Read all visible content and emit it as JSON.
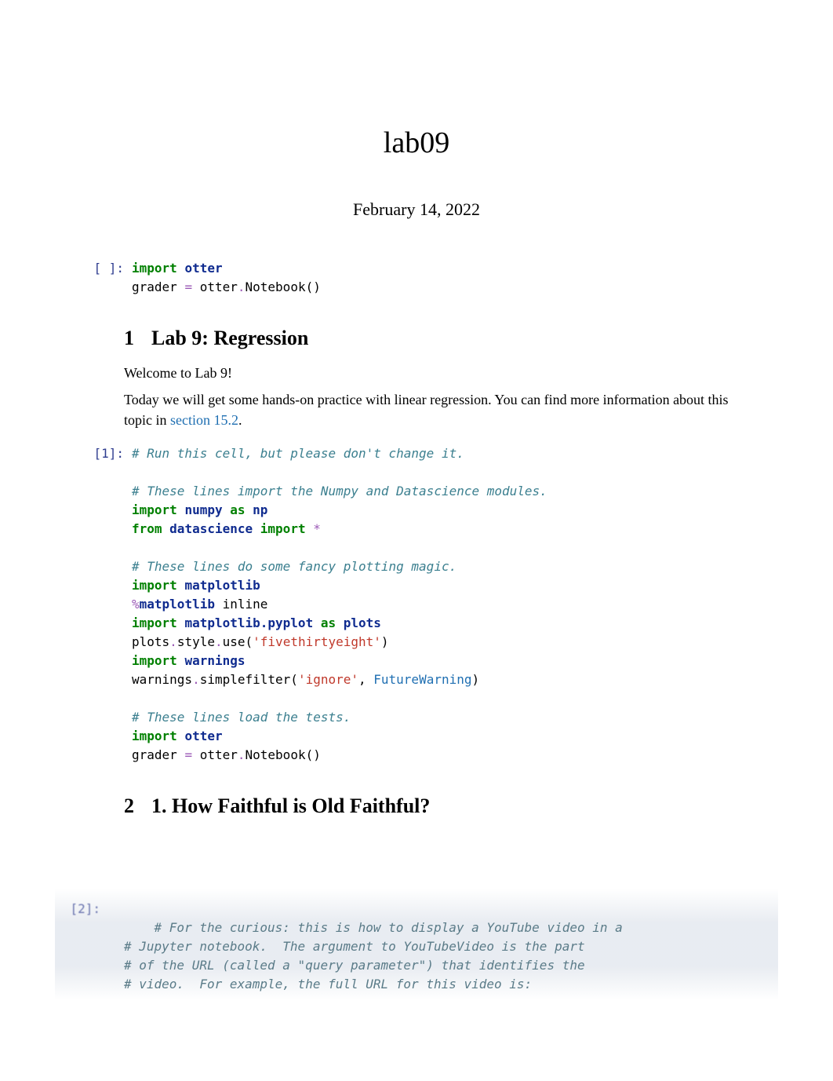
{
  "title": "lab09",
  "date": "February 14, 2022",
  "cells": {
    "c0": {
      "prompt": "[ ]:",
      "lines": {
        "l0": {
          "import": "import",
          "mod": "otter"
        },
        "l1": {
          "var": "grader ",
          "eq": "=",
          "rest": " otter",
          "dot": ".",
          "call": "Notebook()"
        }
      }
    },
    "c1": {
      "prompt": "[1]:",
      "lines": {
        "comment1": "# Run this cell, but please don't change it.",
        "comment2": "# These lines import the Numpy and Datascience modules.",
        "l3": {
          "import": "import",
          "mod": "numpy",
          "as": "as",
          "alias": "np"
        },
        "l4": {
          "from": "from",
          "mod": "datascience",
          "import": "import",
          "star": "*"
        },
        "comment3": "# These lines do some fancy plotting magic.",
        "l6": {
          "import": "import",
          "mod": "matplotlib"
        },
        "l7": {
          "pct": "%",
          "magic": "matplotlib",
          "arg": " inline"
        },
        "l8": {
          "import": "import",
          "mod": "matplotlib.pyplot",
          "as": "as",
          "alias": "plots"
        },
        "l9": {
          "obj": "plots",
          "dot": ".",
          "meth": "style",
          "dot2": ".",
          "call": "use(",
          "str": "'fivethirtyeight'",
          "close": ")"
        },
        "l10": {
          "import": "import",
          "mod": "warnings"
        },
        "l11": {
          "obj": "warnings",
          "dot": ".",
          "call": "simplefilter(",
          "str": "'ignore'",
          "comma": ", ",
          "cls": "FutureWarning",
          "close": ")"
        },
        "comment4": "# These lines load the tests.",
        "l13": {
          "import": "import",
          "mod": "otter"
        },
        "l14": {
          "var": "grader ",
          "eq": "=",
          "rest": " otter",
          "dot": ".",
          "call": "Notebook()"
        }
      }
    },
    "c2": {
      "prompt": "[2]:",
      "lines": {
        "b1": "# For the curious: this is how to display a YouTube video in a",
        "b2": "# Jupyter notebook.  The argument to YouTubeVideo is the part",
        "b3": "# of the URL (called a \"query parameter\") that identifies the",
        "b4": "# video.  For example, the full URL for this video is:"
      }
    }
  },
  "sections": {
    "s1": {
      "num": "1",
      "title": "Lab 9: Regression"
    },
    "s2": {
      "num": "2",
      "title": "1. How Faithful is Old Faithful?"
    }
  },
  "prose": {
    "p1": "Welcome to Lab 9!",
    "p2a": "Today we will get some hands-on practice with linear regression. You can find more information about this topic in ",
    "p2link": "section 15.2",
    "p2b": "."
  }
}
